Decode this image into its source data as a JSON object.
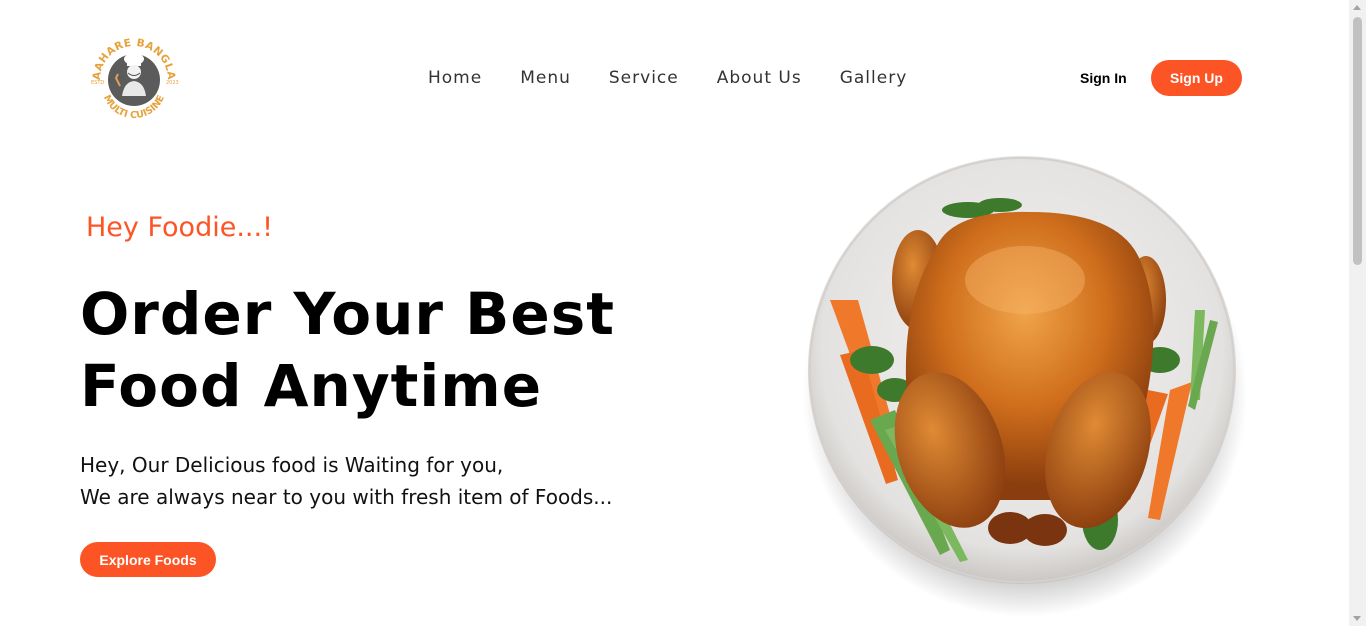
{
  "logo": {
    "top_text": "AAHARE BANGLA",
    "bottom_text": "MULTI CUISINE",
    "left_tag": "ESTD",
    "right_tag": "2023",
    "icon": "chef-logo"
  },
  "nav": {
    "items": [
      {
        "label": "Home"
      },
      {
        "label": "Menu"
      },
      {
        "label": "Service"
      },
      {
        "label": "About Us"
      },
      {
        "label": "Gallery"
      }
    ],
    "signin_label": "Sign In",
    "signup_label": "Sign Up"
  },
  "hero": {
    "greeting": "Hey Foodie...!",
    "headline_line1": "Order Your Best",
    "headline_line2": "Food Anytime",
    "sub_line1": "Hey, Our Delicious food is Waiting for you,",
    "sub_line2": "We are always near to you with fresh item of Foods...",
    "cta_label": "Explore Foods",
    "image": "roast-chicken-plate-image"
  },
  "colors": {
    "accent": "#fd5425",
    "logo_gold": "#e6a23c",
    "text": "#000000",
    "background": "#ffffff"
  }
}
